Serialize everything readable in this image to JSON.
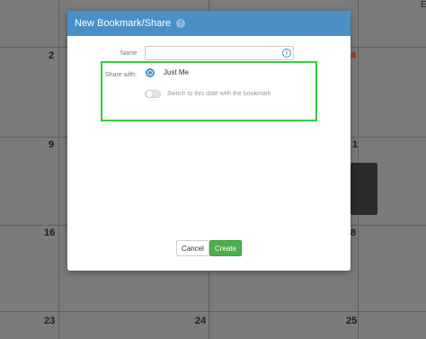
{
  "calendar": {
    "day_numbers": [
      "2",
      "4",
      "9",
      "1",
      "16",
      "8",
      "23",
      "24",
      "25"
    ],
    "partial_text": "E"
  },
  "dialog": {
    "title": "New Bookmark/Share",
    "help_icon": "question-mark-icon",
    "name_label": "Name",
    "name_value": "",
    "info_icon": "info-icon",
    "share_with_label": "Share with:",
    "share_option": "Just Me",
    "toggle_label": "Switch to this date with the bookmark",
    "toggle_on": false,
    "cancel_label": "Cancel",
    "create_label": "Create"
  },
  "colors": {
    "header": "#4a90c7",
    "create_button": "#4cae4c",
    "highlight": "#2fcf3b"
  }
}
